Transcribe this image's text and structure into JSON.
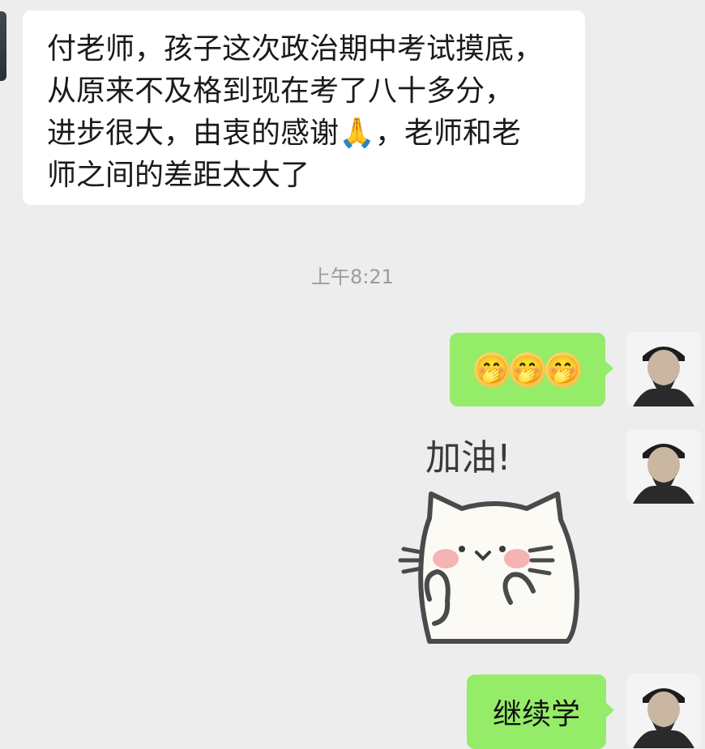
{
  "incoming_message": {
    "lines": [
      "付老师，孩子这次政治期中考试摸底，",
      "从原来不及格到现在考了八十多分，",
      "进步很大，由衷的感谢🙏，老师和老",
      "师之间的差距太大了"
    ]
  },
  "timestamp": "上午8:21",
  "outgoing": {
    "emoji_message": [
      "🤭",
      "🤭",
      "🤭"
    ],
    "sticker_text": "加油!",
    "text_message": "继续学"
  },
  "colors": {
    "background": "#ededed",
    "incoming_bubble": "#ffffff",
    "outgoing_bubble": "#95ec69",
    "timestamp": "#9b9b9b"
  }
}
